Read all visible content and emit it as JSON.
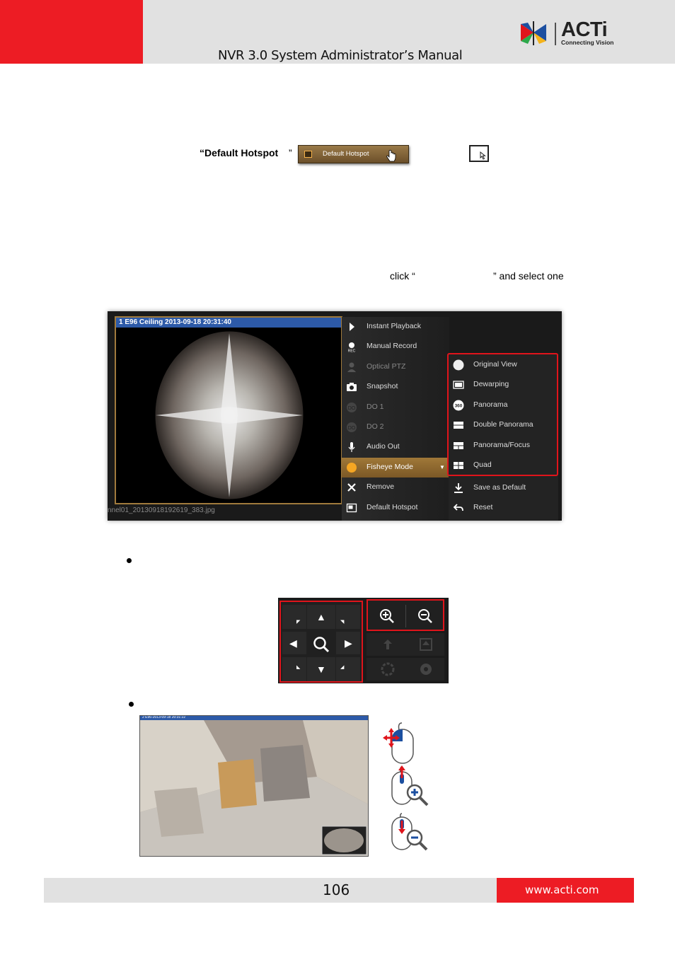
{
  "header": {
    "title": "NVR 3.0 System Administrator’s Manual",
    "logo_word": "ACTi",
    "logo_tagline": "Connecting Vision"
  },
  "body": {
    "default_hotspot_label": "“Default Hotspot",
    "default_hotspot_quote": "”",
    "default_hotspot_button": "Default Hotspot",
    "click_text": "click “",
    "select_text": "” and select one"
  },
  "screenshot1": {
    "video_title": "1 E96 Ceiling   2013-09-18 20:31:40",
    "file_name": "nnel01_20130918192619_383.jpg",
    "menu": [
      {
        "label": "Instant Playback",
        "icon": "play-icon",
        "enabled": true
      },
      {
        "label": "Manual Record",
        "icon": "rec-icon",
        "enabled": true
      },
      {
        "label": "Optical PTZ",
        "icon": "person-icon",
        "enabled": false
      },
      {
        "label": "Snapshot",
        "icon": "camera-icon",
        "enabled": true
      },
      {
        "label": "DO 1",
        "icon": "do-icon",
        "enabled": false
      },
      {
        "label": "DO 2",
        "icon": "do-icon",
        "enabled": false
      },
      {
        "label": "Audio Out",
        "icon": "microphone-icon",
        "enabled": true
      },
      {
        "label": "Fisheye Mode",
        "icon": "fisheye-icon",
        "enabled": true,
        "highlighted": true
      },
      {
        "label": "Remove",
        "icon": "x-icon",
        "enabled": true
      },
      {
        "label": "Default Hotspot",
        "icon": "hotspot-icon",
        "enabled": true
      }
    ],
    "submenu": [
      {
        "label": "Original View",
        "icon": "circle-icon"
      },
      {
        "label": "Dewarping",
        "icon": "dewarp-icon"
      },
      {
        "label": "Panorama",
        "icon": "360-icon"
      },
      {
        "label": "Double Panorama",
        "icon": "double-panorama-icon"
      },
      {
        "label": "Panorama/Focus",
        "icon": "panorama-focus-icon"
      },
      {
        "label": "Quad",
        "icon": "quad-icon"
      },
      {
        "label": "Save as Default",
        "icon": "download-icon"
      },
      {
        "label": "Reset",
        "icon": "reset-icon"
      }
    ]
  },
  "screenshot2": {
    "overlay": "2 E96-2013-09-18 20:31:22"
  },
  "footer": {
    "page_number": "106",
    "website": "www.acti.com"
  }
}
